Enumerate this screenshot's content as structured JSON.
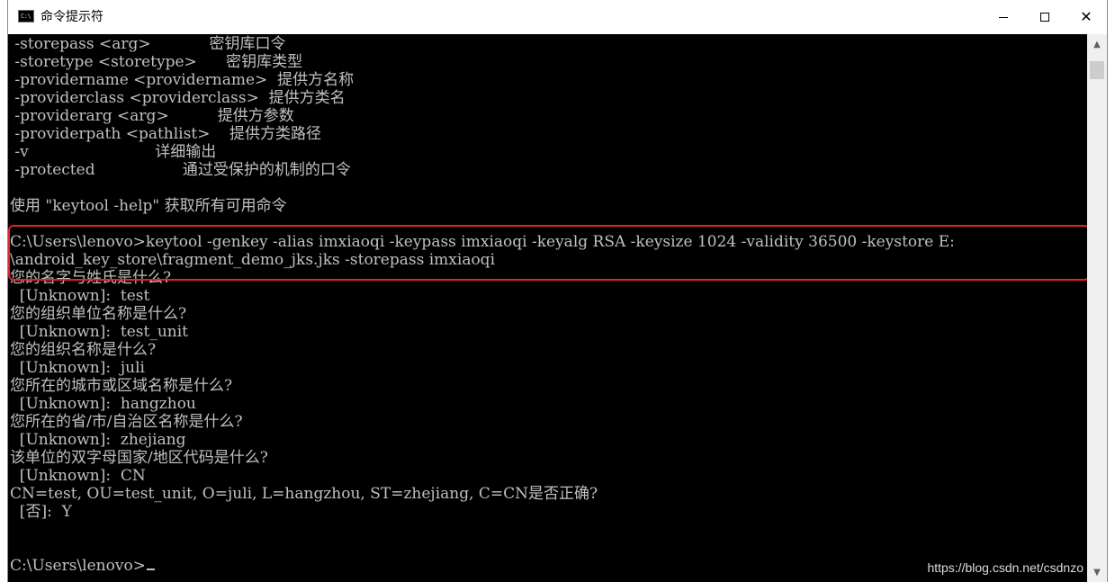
{
  "window": {
    "title": "命令提示符",
    "icon": "cmd-icon",
    "buttons": [
      "minimize-icon",
      "maximize-icon",
      "close-icon"
    ]
  },
  "console": {
    "lines": [
      " -storepass <arg>            密钥库口令",
      " -storetype <storetype>      密钥库类型",
      " -providername <providername>  提供方名称",
      " -providerclass <providerclass>  提供方类名",
      " -providerarg <arg>          提供方参数",
      " -providerpath <pathlist>    提供方类路径",
      " -v                          详细输出",
      " -protected                  通过受保护的机制的口令",
      "",
      "使用 \"keytool -help\" 获取所有可用命令",
      "",
      "C:\\Users\\lenovo>keytool -genkey -alias imxiaoqi -keypass imxiaoqi -keyalg RSA -keysize 1024 -validity 36500 -keystore E:",
      "\\android_key_store\\fragment_demo_jks.jks -storepass imxiaoqi",
      "您的名字与姓氏是什么?",
      "  [Unknown]:  test",
      "您的组织单位名称是什么?",
      "  [Unknown]:  test_unit",
      "您的组织名称是什么?",
      "  [Unknown]:  juli",
      "您所在的城市或区域名称是什么?",
      "  [Unknown]:  hangzhou",
      "您所在的省/市/自治区名称是什么?",
      "  [Unknown]:  zhejiang",
      "该单位的双字母国家/地区代码是什么?",
      "  [Unknown]:  CN",
      "CN=test, OU=test_unit, O=juli, L=hangzhou, ST=zhejiang, C=CN是否正确?",
      "  [否]:  Y",
      "",
      "",
      "C:\\Users\\lenovo>"
    ],
    "watermark": "https://blog.csdn.net/csdnzo"
  },
  "colors": {
    "console_bg": "#000000",
    "console_fg": "#c0c0c0",
    "highlight": "#e3242b"
  }
}
